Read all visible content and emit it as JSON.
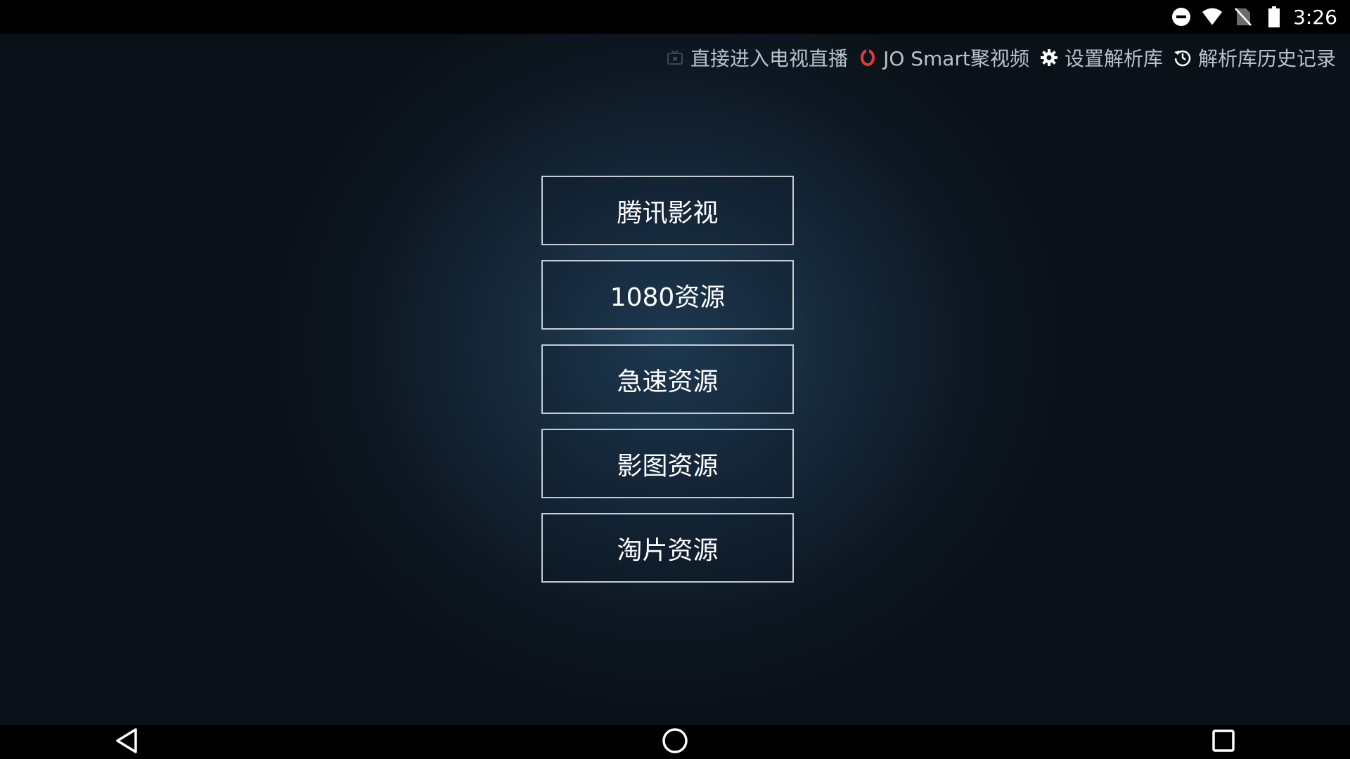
{
  "status_bar": {
    "time": "3:26",
    "icons": [
      "do-not-disturb-icon",
      "wifi-icon",
      "no-sim-icon",
      "battery-icon"
    ]
  },
  "toolbar": {
    "items": [
      {
        "label": "直接进入电视直播",
        "icon": "tv-icon"
      },
      {
        "label": "JO Smart聚视频",
        "icon": "jo-smart-icon"
      },
      {
        "label": "设置解析库",
        "icon": "gear-icon"
      },
      {
        "label": "解析库历史记录",
        "icon": "history-icon"
      }
    ]
  },
  "menu": {
    "buttons": [
      {
        "label": "腾讯影视"
      },
      {
        "label": "1080资源"
      },
      {
        "label": "急速资源"
      },
      {
        "label": "影图资源"
      },
      {
        "label": "淘片资源"
      }
    ]
  },
  "nav_bar": {
    "buttons": [
      "back-icon",
      "home-icon",
      "recents-icon"
    ]
  },
  "colors": {
    "background_center": "#23435c",
    "background_edge": "#0b1118",
    "button_border": "#c4ccd4",
    "toolbar_text": "#b9c2cc",
    "jo_smart_accent": "#e53935"
  }
}
